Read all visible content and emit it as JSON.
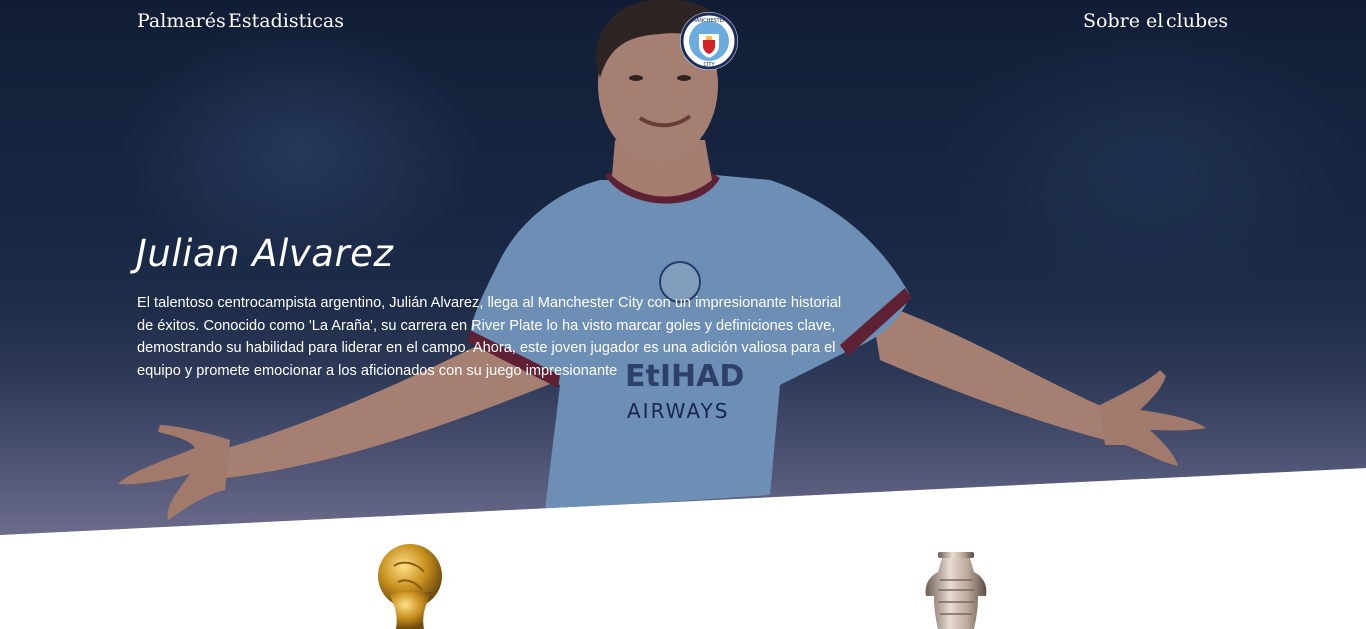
{
  "nav": {
    "left_links": [
      "Palmarés",
      "Estadisticas"
    ],
    "right_links": [
      "Sobre el",
      "clubes"
    ],
    "crest_text": {
      "top": "MANCHESTER",
      "bottom": "CITY"
    }
  },
  "hero": {
    "title": "Julian Alvarez",
    "description": "El talentoso centrocampista argentino, Julián Alvarez, llega al Manchester City con un impresionante historial de éxitos. Conocido como 'La Araña', su carrera en River Plate lo ha visto marcar goles y definiciones clave, demostrando su habilidad para liderar en el campo. Ahora, este joven jugador es una adición valiosa para el equipo y promete emocionar a los aficionados con su juego impresionante",
    "shirt_sponsor": "AIRWAYS",
    "shirt_sponsor_top": "EtIHAD"
  },
  "colors": {
    "jersey": "#8fb9e3",
    "hero_dark": "#13213a",
    "crest_navy": "#1c2c5b",
    "crest_red": "#d2232a",
    "gold": "#c8901e",
    "silver": "#b9a79a"
  },
  "trophies": [
    {
      "icon": "world-cup-trophy-icon"
    },
    {
      "icon": "copa-america-trophy-icon"
    }
  ]
}
